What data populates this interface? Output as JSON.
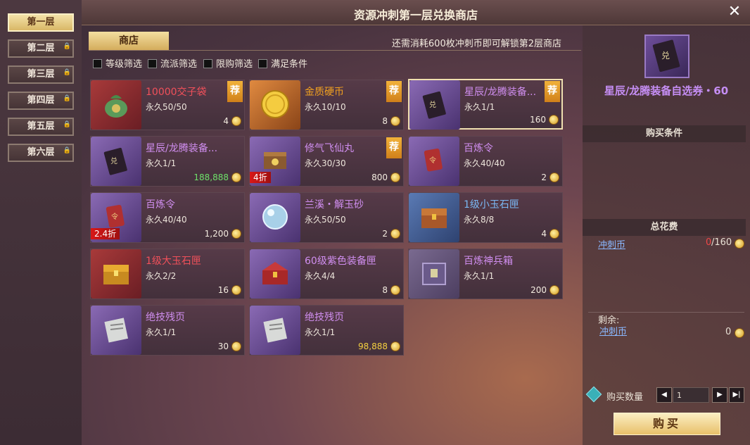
{
  "window": {
    "title": "资源冲刺第一层兑换商店",
    "close_label": "✕"
  },
  "floors": [
    {
      "label": "第一层",
      "locked": false,
      "active": true
    },
    {
      "label": "第二层",
      "locked": true
    },
    {
      "label": "第三层",
      "locked": true
    },
    {
      "label": "第四层",
      "locked": true
    },
    {
      "label": "第五层",
      "locked": true
    },
    {
      "label": "第六层",
      "locked": true
    }
  ],
  "shop": {
    "tab_label": "商店",
    "unlock_text": "还需消耗600枚冲刺币即可解锁第2层商店"
  },
  "filters": [
    "等级筛选",
    "流派筛选",
    "限购筛选",
    "满足条件"
  ],
  "items": [
    {
      "name": "10000交子袋",
      "limit": "永久50/50",
      "price": "4",
      "rec": "荐",
      "discount": "",
      "color": "#f0505a"
    },
    {
      "name": "金质硬币",
      "limit": "永久10/10",
      "price": "8",
      "rec": "荐",
      "discount": "",
      "color": "#f0a020"
    },
    {
      "name": "星辰/龙腾装备...",
      "limit": "永久1/1",
      "price": "160",
      "rec": "荐",
      "discount": "",
      "color": "#d08ef0"
    },
    {
      "name": "星辰/龙腾装备...",
      "limit": "永久1/1",
      "price": "188,888",
      "rec": "",
      "discount": "",
      "color": "#d08ef0",
      "price_color": "#6ee06a"
    },
    {
      "name": "修气飞仙丸",
      "limit": "永久30/30",
      "price": "800",
      "rec": "荐",
      "discount": "4折",
      "color": "#d08ef0"
    },
    {
      "name": "百炼令",
      "limit": "永久40/40",
      "price": "2",
      "rec": "",
      "discount": "",
      "color": "#d08ef0"
    },
    {
      "name": "百炼令",
      "limit": "永久40/40",
      "price": "1,200",
      "rec": "",
      "discount": "2.4折",
      "color": "#d08ef0"
    },
    {
      "name": "兰溪・解玉砂",
      "limit": "永久50/50",
      "price": "2",
      "rec": "",
      "discount": "",
      "color": "#d08ef0"
    },
    {
      "name": "1级小玉石匣",
      "limit": "永久8/8",
      "price": "4",
      "rec": "",
      "discount": "",
      "color": "#7ab8f4"
    },
    {
      "name": "1级大玉石匣",
      "limit": "永久2/2",
      "price": "16",
      "rec": "",
      "discount": "",
      "color": "#f0505a"
    },
    {
      "name": "60级紫色装备匣",
      "limit": "永久4/4",
      "price": "8",
      "rec": "",
      "discount": "",
      "color": "#d08ef0"
    },
    {
      "name": "百炼神兵箱",
      "limit": "永久1/1",
      "price": "200",
      "rec": "",
      "discount": "",
      "color": "#d08ef0"
    },
    {
      "name": "绝技残页",
      "limit": "永久1/1",
      "price": "30",
      "rec": "",
      "discount": "",
      "color": "#d08ef0"
    },
    {
      "name": "绝技残页",
      "limit": "永久1/1",
      "price": "98,888",
      "rec": "",
      "discount": "",
      "color": "#d08ef0",
      "price_color": "#f4d040"
    }
  ],
  "selected": {
    "name": "星辰/龙腾装备自选券・60"
  },
  "right": {
    "buy_cond": "购买条件",
    "total_cost": "总花费",
    "currency": "冲刺币",
    "cost_have": "0",
    "cost_need": "/160",
    "remain_label": "剩余:",
    "remain_currency": "冲刺币",
    "remain_value": "0",
    "qty_label": "购买数量",
    "qty_value": "1",
    "buy_label": "购买"
  }
}
